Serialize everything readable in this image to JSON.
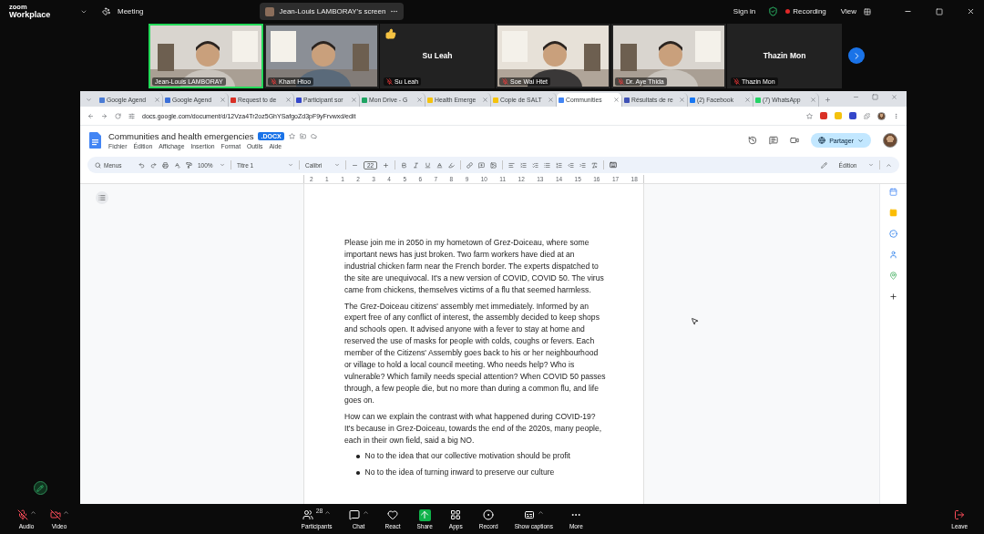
{
  "zoom_bar": {
    "brand_top": "zoom",
    "brand": "Workplace",
    "meeting": "Meeting",
    "share_label": "Jean-Louis LAMBORAY's screen",
    "sign_in": "Sign in",
    "recording": "Recording",
    "view": "View"
  },
  "participants": [
    {
      "name": "Jean-Louis LAMBORAY",
      "kind": "video",
      "muted": false,
      "speaking": true,
      "reacting": false
    },
    {
      "name": "Khant Htoo",
      "kind": "video",
      "muted": true,
      "speaking": false,
      "reacting": false
    },
    {
      "name": "Su Leah",
      "heading": "Su Leah",
      "kind": "name",
      "muted": true,
      "speaking": false,
      "reacting": true
    },
    {
      "name": "Soe Wai Htet",
      "kind": "video",
      "muted": true,
      "speaking": false,
      "reacting": false
    },
    {
      "name": "Dr. Aye Thida",
      "kind": "video",
      "muted": true,
      "speaking": false,
      "reacting": false
    },
    {
      "name": "Thazin Mon",
      "heading": "Thazin Mon",
      "kind": "name",
      "muted": true,
      "speaking": false,
      "reacting": false
    }
  ],
  "browser": {
    "tabs": [
      {
        "title": "Google Agend",
        "selected": false,
        "color": "#4a7bd4"
      },
      {
        "title": "Google Agend",
        "selected": false,
        "color": "#3b6fd8"
      },
      {
        "title": "Request to de",
        "selected": false,
        "color": "#d93025"
      },
      {
        "title": "Participant sor",
        "selected": false,
        "color": "#3446c9"
      },
      {
        "title": "Mon Drive - G",
        "selected": false,
        "color": "#1fa463"
      },
      {
        "title": "Health Emerge",
        "selected": false,
        "color": "#f4c20d"
      },
      {
        "title": "Copie de SALT",
        "selected": false,
        "color": "#f4c20d"
      },
      {
        "title": "Communities",
        "selected": true,
        "color": "#4285f4"
      },
      {
        "title": "Résultats de re",
        "selected": false,
        "color": "#3f51b5"
      },
      {
        "title": "(2) Facebook",
        "selected": false,
        "color": "#1877f2"
      },
      {
        "title": "(7) WhatsApp",
        "selected": false,
        "color": "#25d366"
      }
    ],
    "url": "docs.google.com/document/d/12Vza4Tr2oz5GhYSafgoZd3pF9yFrvwxd/edit"
  },
  "document": {
    "title": "Communities and health emergencies",
    "badge": ".DOCX",
    "menus": [
      "Fichier",
      "Édition",
      "Affichage",
      "Insertion",
      "Format",
      "Outils",
      "Aide"
    ],
    "share_button": "Partager",
    "toolbar": {
      "search": "Menus",
      "zoom": "100%",
      "style": "Titre 1",
      "font": "Calibri",
      "font_size": "22",
      "mode": "Édition"
    },
    "ruler": [
      "2",
      "1",
      "1",
      "2",
      "3",
      "4",
      "5",
      "6",
      "7",
      "8",
      "9",
      "10",
      "11",
      "12",
      "13",
      "14",
      "15",
      "16",
      "17",
      "18"
    ],
    "body": [
      {
        "kind": "paragraph",
        "text": "Please join me in 2050 in my hometown of Grez-Doiceau, where some important news has just broken.  Two farm workers have died at an industrial chicken farm near the French border.  The experts dispatched to the site are unequivocal. It's a new version of COVID, COVID 50. The virus came from chickens, themselves victims of a flu that seemed harmless."
      },
      {
        "kind": "paragraph",
        "text": "The Grez-Doiceau citizens' assembly met immediately. Informed by an expert free of any conflict of interest, the assembly decided to keep shops and schools open. It advised anyone with a fever to stay at home and reserved the use of masks for people with colds, coughs or fevers. Each member of the Citizens' Assembly goes back to his or her neighbourhood or village to hold a local council meeting. Who needs help? Who is vulnerable? Which family needs special attention? When COVID 50 passes through, a few people die, but no more than during a common flu, and life goes on."
      },
      {
        "kind": "paragraph",
        "text": "How can we explain the contrast with what happened during COVID-19? It's because in Grez-Doiceau, towards the end of the 2020s, many people, each in their own field, said a big NO."
      },
      {
        "kind": "bullet",
        "text": "No to the idea that our collective motivation should be profit"
      },
      {
        "kind": "bullet",
        "text": "No to the idea of turning inward to preserve our culture"
      }
    ]
  },
  "controls": [
    {
      "kind": "audio",
      "label": "Audio",
      "off": true,
      "menu": true
    },
    {
      "kind": "video",
      "label": "Video",
      "off": true,
      "menu": true
    },
    {
      "kind": "participants",
      "label": "Participants",
      "count": "28",
      "off": false,
      "menu": true
    },
    {
      "kind": "chat",
      "label": "Chat",
      "off": false,
      "menu": true
    },
    {
      "kind": "react",
      "label": "React",
      "off": false,
      "menu": false
    },
    {
      "kind": "share",
      "label": "Share",
      "off": false,
      "menu": false
    },
    {
      "kind": "apps",
      "label": "Apps",
      "off": false,
      "menu": false
    },
    {
      "kind": "record",
      "label": "Record",
      "off": false,
      "menu": false
    },
    {
      "kind": "captions",
      "label": "Show captions",
      "off": false,
      "menu": true
    },
    {
      "kind": "more",
      "label": "More",
      "off": false,
      "menu": false
    },
    {
      "kind": "leave",
      "label": "Leave",
      "off": false,
      "menu": false
    }
  ]
}
